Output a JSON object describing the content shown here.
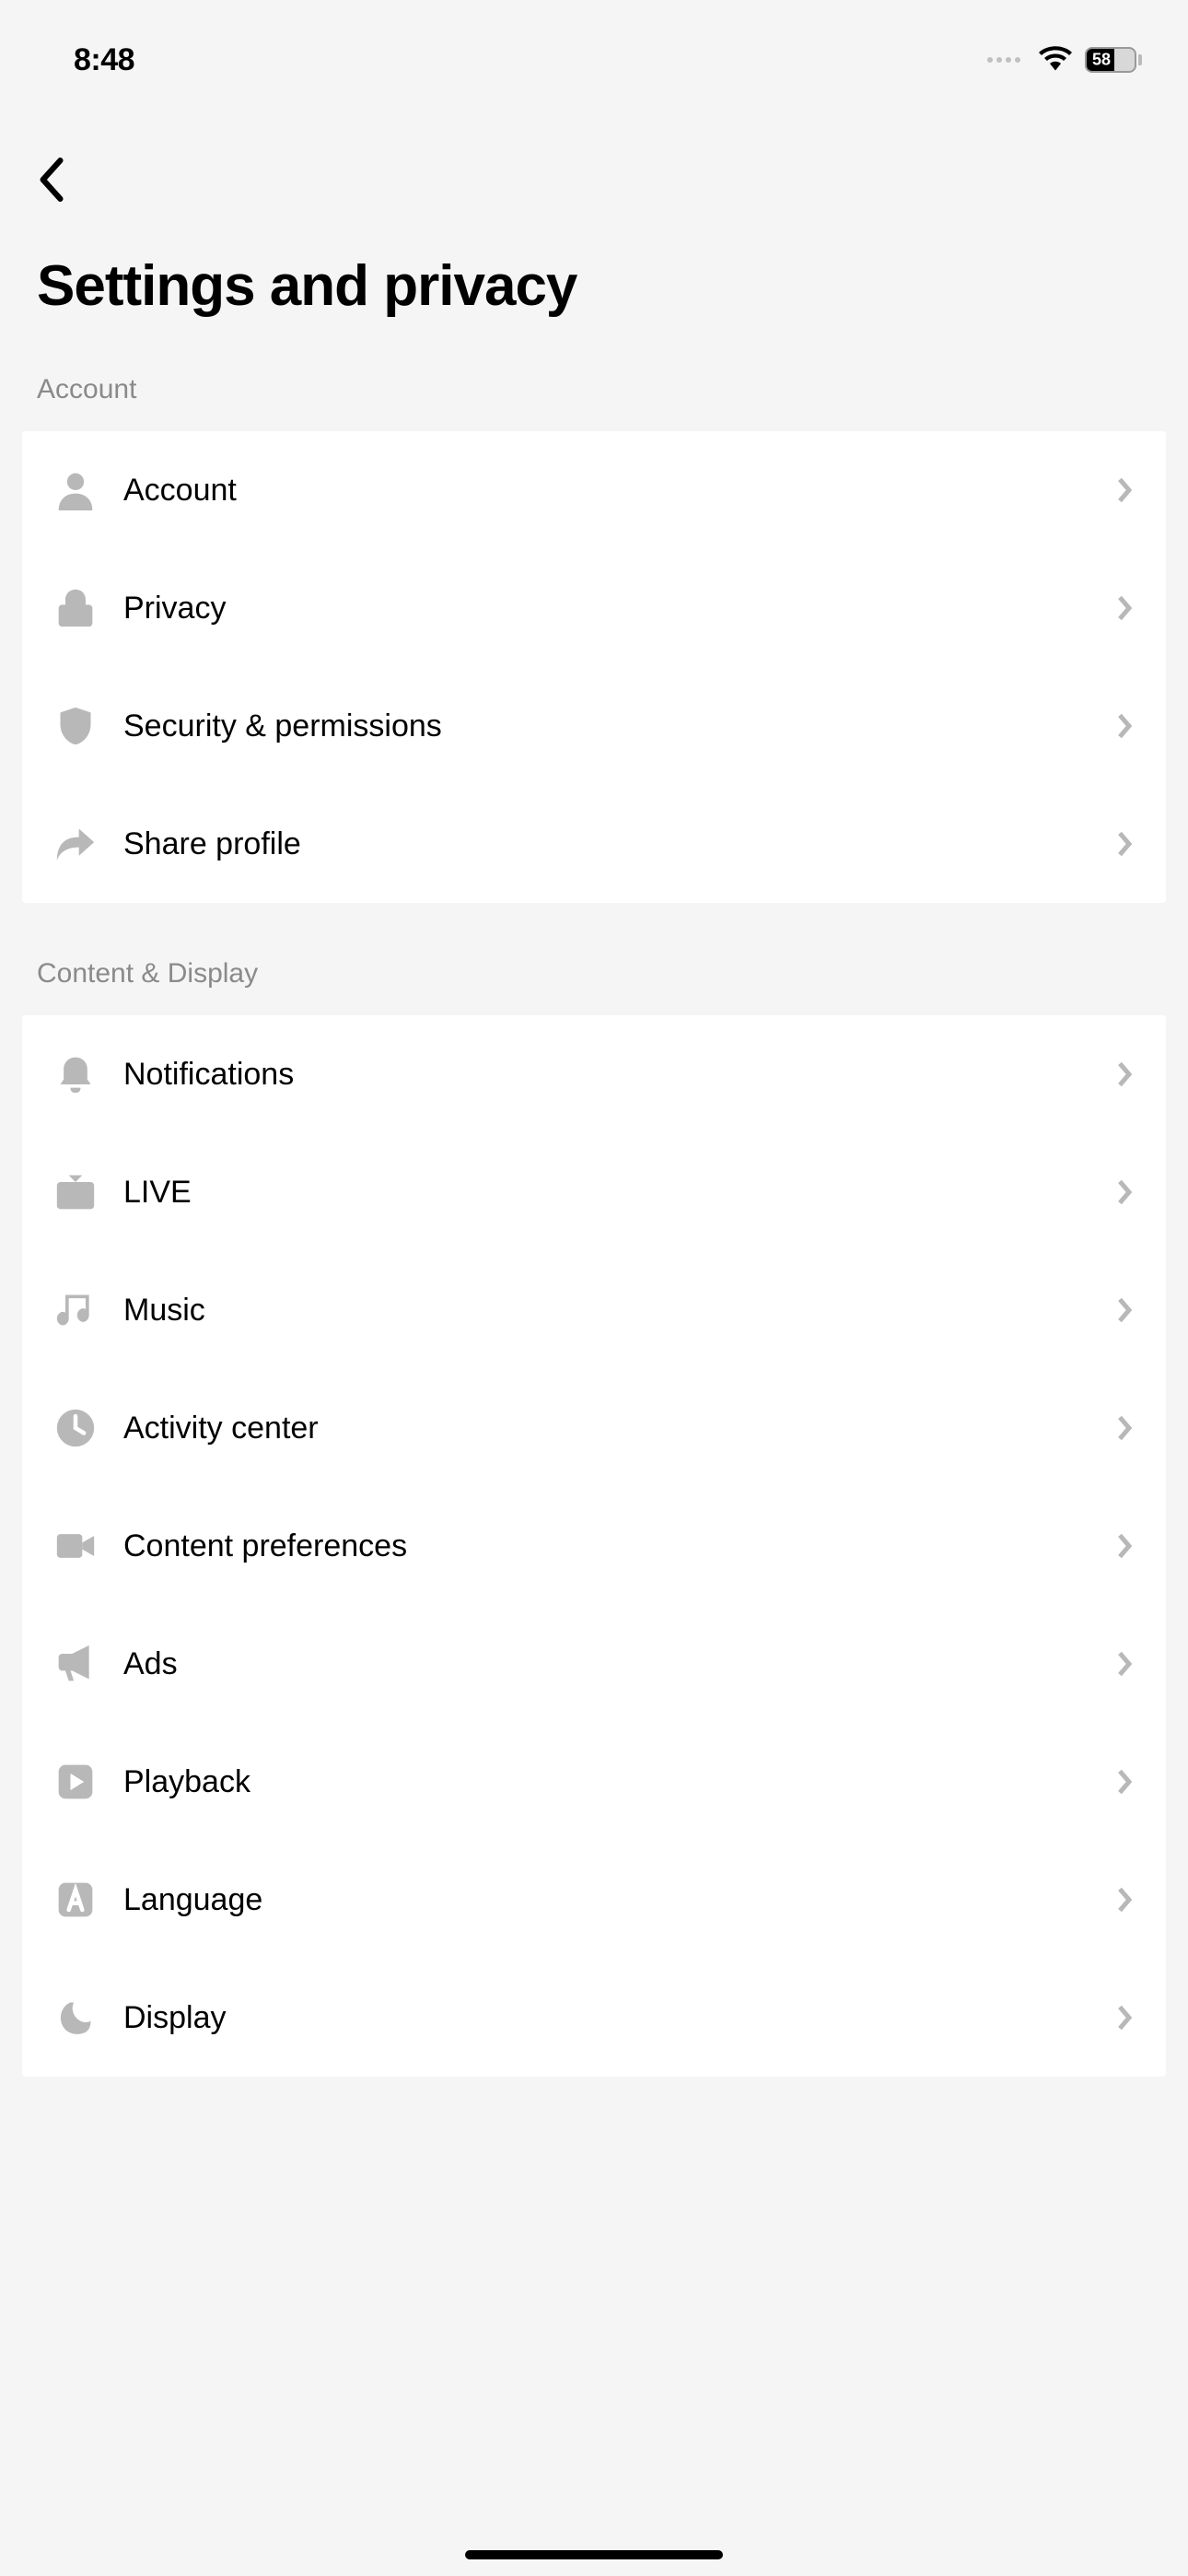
{
  "status": {
    "time": "8:48",
    "battery": "58"
  },
  "page": {
    "title": "Settings and privacy"
  },
  "sections": {
    "account": {
      "header": "Account",
      "items": {
        "account": "Account",
        "privacy": "Privacy",
        "security": "Security & permissions",
        "share": "Share profile"
      }
    },
    "content": {
      "header": "Content & Display",
      "items": {
        "notifications": "Notifications",
        "live": "LIVE",
        "music": "Music",
        "activity": "Activity center",
        "preferences": "Content preferences",
        "ads": "Ads",
        "playback": "Playback",
        "language": "Language",
        "display": "Display"
      }
    }
  }
}
